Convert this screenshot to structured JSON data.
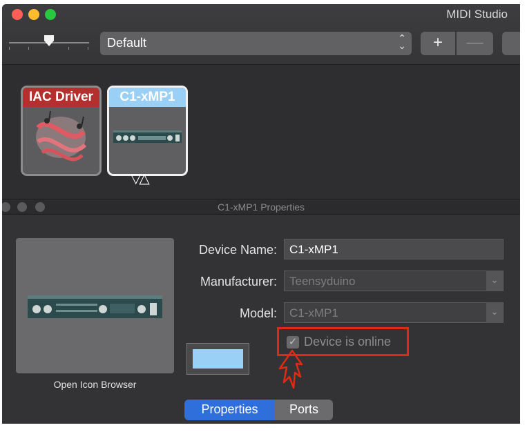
{
  "window": {
    "title": "MIDI Studio"
  },
  "toolbar": {
    "configuration": "Default",
    "add_label": "+",
    "remove_label": "—"
  },
  "devices": [
    {
      "name": "IAC Driver",
      "color": "#b3302f"
    },
    {
      "name": "C1-xMP1",
      "color": "#9ad0f5"
    }
  ],
  "properties_panel": {
    "title": "C1-xMP1 Properties",
    "icon_browser_label": "Open Icon Browser",
    "fields": {
      "device_name": {
        "label": "Device Name:",
        "value": "C1-xMP1"
      },
      "manufacturer": {
        "label": "Manufacturer:",
        "value": "Teensyduino"
      },
      "model": {
        "label": "Model:",
        "value": "C1-xMP1"
      }
    },
    "device_color": "#9ad0f5",
    "online_checkbox": {
      "label": "Device is online",
      "checked": true
    },
    "tabs": [
      {
        "label": "Properties",
        "selected": true
      },
      {
        "label": "Ports",
        "selected": false
      }
    ]
  },
  "annotation": {
    "highlight_color": "#e02b12"
  }
}
